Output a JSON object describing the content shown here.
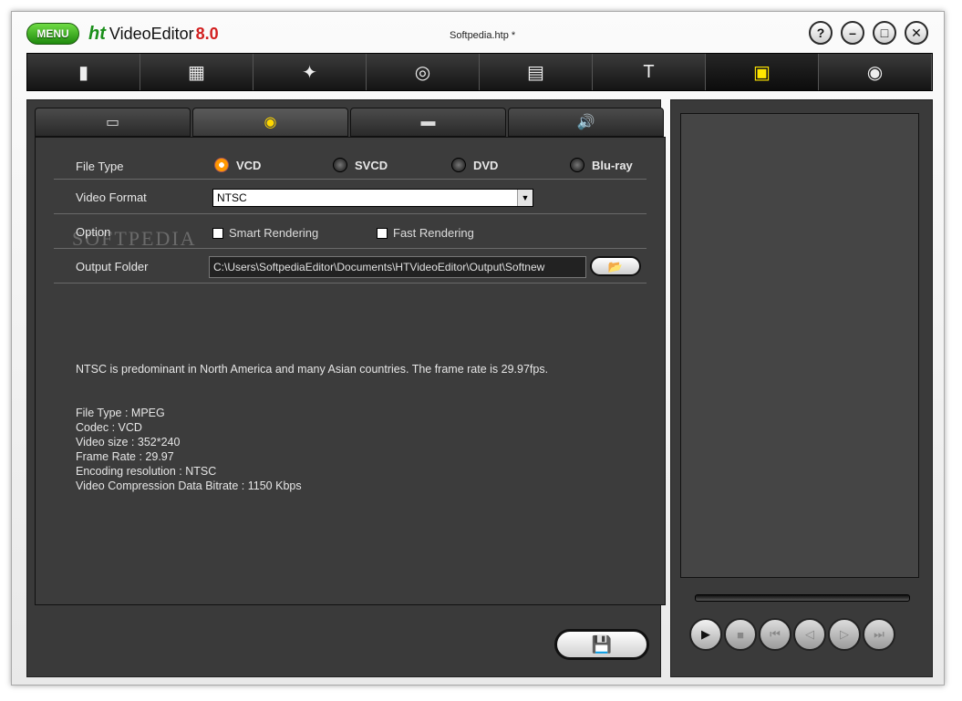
{
  "titlebar": {
    "menu_label": "MENU",
    "logo_prefix": "ht",
    "logo_name": "VideoEditor",
    "logo_version": "8.0",
    "document_title": "Softpedia.htp *",
    "help": "?",
    "minimize": "–",
    "maximize": "□",
    "close": "✕"
  },
  "toolbar": [
    {
      "icon": "new-page-icon",
      "glyph": "▮"
    },
    {
      "icon": "camera-capture-icon",
      "glyph": "▦"
    },
    {
      "icon": "magic-wand-icon",
      "glyph": "✦"
    },
    {
      "icon": "transition-icon",
      "glyph": "◎"
    },
    {
      "icon": "filmstrip-icon",
      "glyph": "▤"
    },
    {
      "icon": "text-icon",
      "glyph": "T"
    },
    {
      "icon": "save-disk-icon",
      "glyph": "▣"
    },
    {
      "icon": "disc-burn-icon",
      "glyph": "◉"
    }
  ],
  "tabs": [
    {
      "icon": "film-icon",
      "glyph": "▭"
    },
    {
      "icon": "disc-icon",
      "glyph": "◉"
    },
    {
      "icon": "clapper-icon",
      "glyph": "▬"
    },
    {
      "icon": "speaker-icon",
      "glyph": "🔊"
    }
  ],
  "form": {
    "file_type_label": "File Type",
    "file_types": [
      "VCD",
      "SVCD",
      "DVD",
      "Blu-ray"
    ],
    "video_format_label": "Video Format",
    "video_format_value": "NTSC",
    "option_label": "Option",
    "smart_rendering": "Smart Rendering",
    "fast_rendering": "Fast Rendering",
    "output_folder_label": "Output Folder",
    "output_folder_value": "C:\\Users\\SoftpediaEditor\\Documents\\HTVideoEditor\\Output\\Softnew"
  },
  "info": {
    "description": "NTSC is predominant in North America and many Asian countries. The frame rate is 29.97fps.",
    "file_type": "File Type : MPEG",
    "codec": "Codec : VCD",
    "video_size": "Video size : 352*240",
    "frame_rate": "Frame Rate : 29.97",
    "encoding": "Encoding resolution : NTSC",
    "bitrate": "Video Compression Data Bitrate : 1150 Kbps"
  },
  "watermark": "SOFTPEDIA",
  "colors": {
    "accent": "#ffe600",
    "selected_radio": "#ff9800"
  }
}
